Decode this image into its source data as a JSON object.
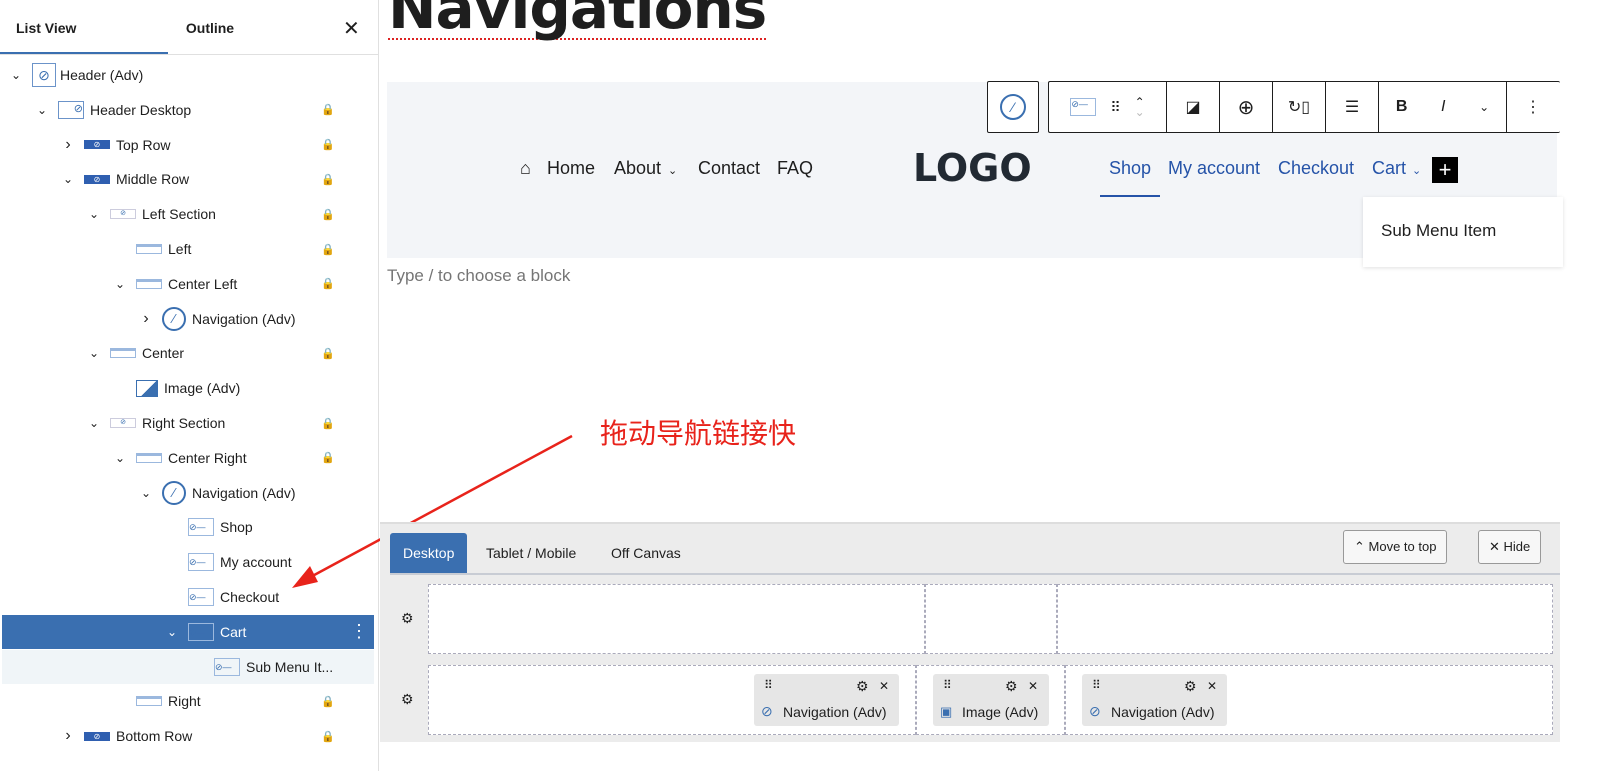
{
  "sidebar": {
    "tabs": [
      "List View",
      "Outline"
    ],
    "items": [
      {
        "label": "Header (Adv)",
        "level": 0,
        "chevron": "down",
        "icon": "navigation-box-icon",
        "locked": false
      },
      {
        "label": "Header Desktop",
        "level": 1,
        "chevron": "down",
        "icon": "desktop-icon",
        "locked": true
      },
      {
        "label": "Top Row",
        "level": 2,
        "chevron": "right",
        "icon": "row-icon",
        "locked": true
      },
      {
        "label": "Middle Row",
        "level": 2,
        "chevron": "down",
        "icon": "row-icon",
        "locked": true
      },
      {
        "label": "Left Section",
        "level": 3,
        "chevron": "down",
        "icon": "section-icon",
        "locked": true
      },
      {
        "label": "Left",
        "level": 4,
        "chevron": "",
        "icon": "column-icon",
        "locked": true
      },
      {
        "label": "Center Left",
        "level": 4,
        "chevron": "down",
        "icon": "column-icon",
        "locked": true
      },
      {
        "label": "Navigation (Adv)",
        "level": 5,
        "chevron": "right",
        "icon": "navigation-icon",
        "locked": false
      },
      {
        "label": "Center",
        "level": 3,
        "chevron": "down",
        "icon": "column-icon",
        "locked": true
      },
      {
        "label": "Image (Adv)",
        "level": 4,
        "chevron": "",
        "icon": "image-icon",
        "locked": false
      },
      {
        "label": "Right Section",
        "level": 3,
        "chevron": "down",
        "icon": "section-icon",
        "locked": true
      },
      {
        "label": "Center Right",
        "level": 4,
        "chevron": "down",
        "icon": "column-icon",
        "locked": true
      },
      {
        "label": "Navigation (Adv)",
        "level": 5,
        "chevron": "down",
        "icon": "navigation-icon",
        "locked": false
      },
      {
        "label": "Shop",
        "level": 6,
        "chevron": "",
        "icon": "nav-link-icon",
        "locked": false
      },
      {
        "label": "My account",
        "level": 6,
        "chevron": "",
        "icon": "nav-link-icon",
        "locked": false
      },
      {
        "label": "Checkout",
        "level": 6,
        "chevron": "",
        "icon": "nav-link-icon",
        "locked": false
      },
      {
        "label": "Cart",
        "level": 6,
        "chevron": "down",
        "icon": "nav-link-icon",
        "locked": false,
        "selected": true
      },
      {
        "label": "Sub Menu It...",
        "level": 7,
        "chevron": "",
        "icon": "nav-link-icon",
        "locked": false,
        "sub": true
      },
      {
        "label": "Right",
        "level": 4,
        "chevron": "",
        "icon": "column-icon",
        "locked": true
      },
      {
        "label": "Bottom Row",
        "level": 2,
        "chevron": "right",
        "icon": "row-icon",
        "locked": true
      }
    ]
  },
  "main": {
    "title": "Navigations",
    "placeholder": "Type / to choose a block",
    "nav_left": [
      "Home",
      "About",
      "Contact",
      "FAQ"
    ],
    "logo": "LOGO",
    "nav_right": [
      "Shop",
      "My account",
      "Checkout",
      "Cart"
    ],
    "submenu": "Sub Menu Item",
    "toolbar": {
      "bold": "B",
      "italic": "I"
    }
  },
  "annotation": "拖动导航链接快",
  "panel": {
    "tabs": [
      "Desktop",
      "Tablet / Mobile",
      "Off Canvas"
    ],
    "move_to_top": "Move to top",
    "hide": "Hide",
    "chips": [
      "Navigation (Adv)",
      "Image (Adv)",
      "Navigation (Adv)"
    ]
  },
  "colors": {
    "accent": "#3a6fb0",
    "link": "#2553a8",
    "annotation": "#e8231b"
  }
}
